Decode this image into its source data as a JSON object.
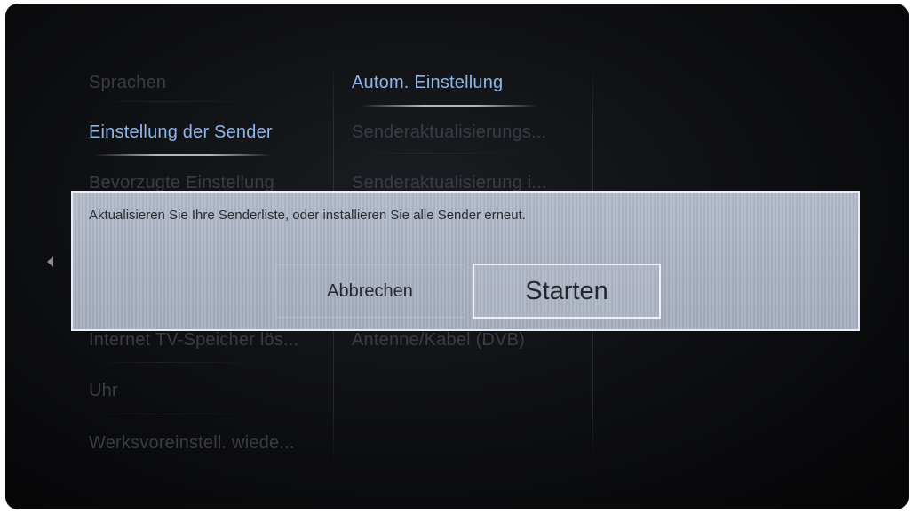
{
  "left_menu": {
    "items": [
      {
        "label": "Sprachen"
      },
      {
        "label": "Einstellung der Sender"
      },
      {
        "label": "Bevorzugte Einstellung"
      },
      {
        "label": "Internet TV-Speicher lös..."
      },
      {
        "label": "Uhr"
      },
      {
        "label": "Werksvoreinstell. wiede..."
      }
    ]
  },
  "mid_menu": {
    "items": [
      {
        "label": "Autom. Einstellung"
      },
      {
        "label": "Senderaktualisierungs..."
      },
      {
        "label": "Senderaktualisierung i..."
      },
      {
        "label": "Antenne/Kabel (DVB)"
      }
    ]
  },
  "dialog": {
    "message": "Aktualisieren Sie Ihre Senderliste, oder installieren Sie alle Sender erneut.",
    "cancel_label": "Abbrechen",
    "start_label": "Starten"
  },
  "colors": {
    "selected_text": "#8fb6ea",
    "dim_text": "#3a3d44",
    "dialog_bg": "#aab2c3"
  }
}
